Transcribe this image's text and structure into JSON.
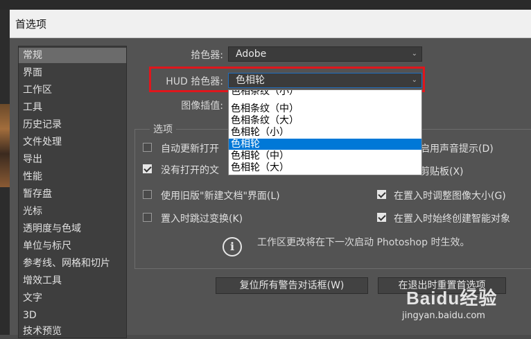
{
  "window": {
    "title": "首选项"
  },
  "sidebar": {
    "items": [
      {
        "label": "常规",
        "active": true
      },
      {
        "label": "界面"
      },
      {
        "label": "工作区"
      },
      {
        "label": "工具"
      },
      {
        "label": "历史记录"
      },
      {
        "label": "文件处理"
      },
      {
        "label": "导出"
      },
      {
        "label": "性能"
      },
      {
        "label": "暂存盘"
      },
      {
        "label": "光标"
      },
      {
        "label": "透明度与色域"
      },
      {
        "label": "单位与标尺"
      },
      {
        "label": "参考线、网格和切片"
      },
      {
        "label": "增效工具"
      },
      {
        "label": "文字"
      },
      {
        "label": "3D"
      },
      {
        "label": "技术预览"
      }
    ]
  },
  "general": {
    "color_picker_label": "拾色器:",
    "color_picker_value": "Adobe",
    "hud_picker_label": "HUD 拾色器:",
    "hud_picker_value": "色相轮",
    "interpolation_label": "图像插值:",
    "hud_options": [
      "色相条纹（小）",
      "色相条纹（中）",
      "色相条纹（大）",
      "色相轮（小）",
      "色相轮",
      "色相轮（中）",
      "色相轮（大）"
    ],
    "hud_selected_index": 4
  },
  "options": {
    "title": "选项",
    "items": [
      {
        "label": "自动更新打开",
        "checked": false
      },
      {
        "label": "启用声音提示(D)",
        "checked": false
      },
      {
        "label": "没有打开的文",
        "checked": true
      },
      {
        "label": "剪贴板(X)",
        "checked": false
      },
      {
        "label": "使用旧版\"新建文档\"界面(L)",
        "checked": false
      },
      {
        "label": "在置入时调整图像大小(G)",
        "checked": true
      },
      {
        "label": "置入时跳过变换(K)",
        "checked": false
      },
      {
        "label": "在置入时始终创建智能对象",
        "checked": true
      }
    ]
  },
  "notice": {
    "text": "工作区更改将在下一次启动 Photoshop 时生效。"
  },
  "buttons": {
    "reset_warnings": "复位所有警告对话框(W)",
    "reset_prefs": "在退出时重置首选项"
  },
  "watermark": {
    "brand": "Baidu经验",
    "url": "jingyan.baidu.com"
  },
  "icons": {
    "chevron": "chevron-down-icon",
    "info": "info-icon",
    "check": "check-icon"
  },
  "colors": {
    "highlight_red": "#e0161c",
    "selection_blue": "#0078d7"
  }
}
